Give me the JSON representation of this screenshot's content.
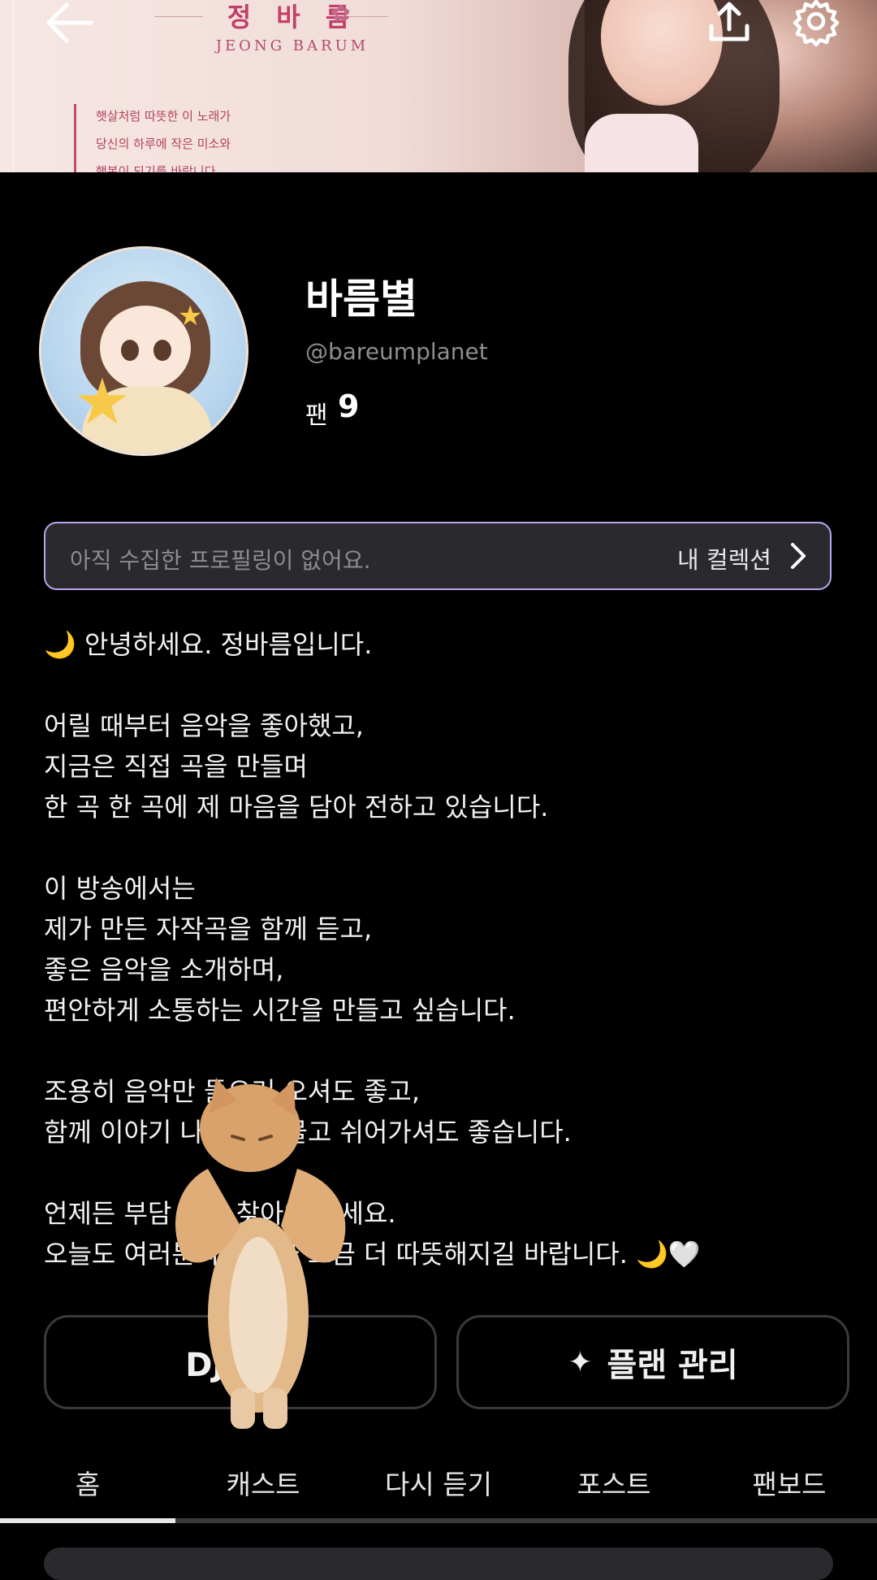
{
  "banner": {
    "title": "정 바 름",
    "subtitle": "JEONG BARUM",
    "quote_lines": [
      "햇살처럼 따뜻한 이 노래가",
      "당신의 하루에 작은 미소와",
      "행복이 되기를 바랍니다"
    ]
  },
  "icons": {
    "back": "back-arrow-icon",
    "share": "share-icon",
    "settings": "gear-icon",
    "chevron": "chevron-right-icon",
    "sparkle": "sparkle-icon"
  },
  "profile": {
    "name": "바름별",
    "handle": "@bareumplanet",
    "fans_label": "팬",
    "fans_count": "9"
  },
  "collection": {
    "empty_text": "아직 수집한 프로필링이 없어요.",
    "link_label": "내 컬렉션"
  },
  "bio_lines": [
    "🌙 안녕하세요. 정바름입니다.",
    "",
    "어릴 때부터 음악을 좋아했고,",
    "지금은 직접 곡을 만들며",
    "한 곡 한 곡에 제 마음을 담아 전하고 있습니다.",
    "",
    "이 방송에서는",
    "제가 만든 자작곡을 함께 듣고,",
    "좋은 음악을 소개하며,",
    "편안하게 소통하는 시간을 만들고 싶습니다.",
    "",
    "조용히 음악만 들으러 오셔도 좋고,",
    "함께 이야기 나누며 머물고 쉬어가셔도 좋습니다.",
    "",
    "언제든 부담 없이 찾아와 주세요.",
    "오늘도 여러분의 하루가 조금 더 따뜻해지길 바랍니다. 🌙🤍"
  ],
  "buttons": {
    "dj": "DJ 메뉴",
    "plan": "플랜 관리"
  },
  "tabs": [
    "홈",
    "캐스트",
    "다시 듣기",
    "포스트",
    "팬보드"
  ],
  "active_tab_index": 0
}
